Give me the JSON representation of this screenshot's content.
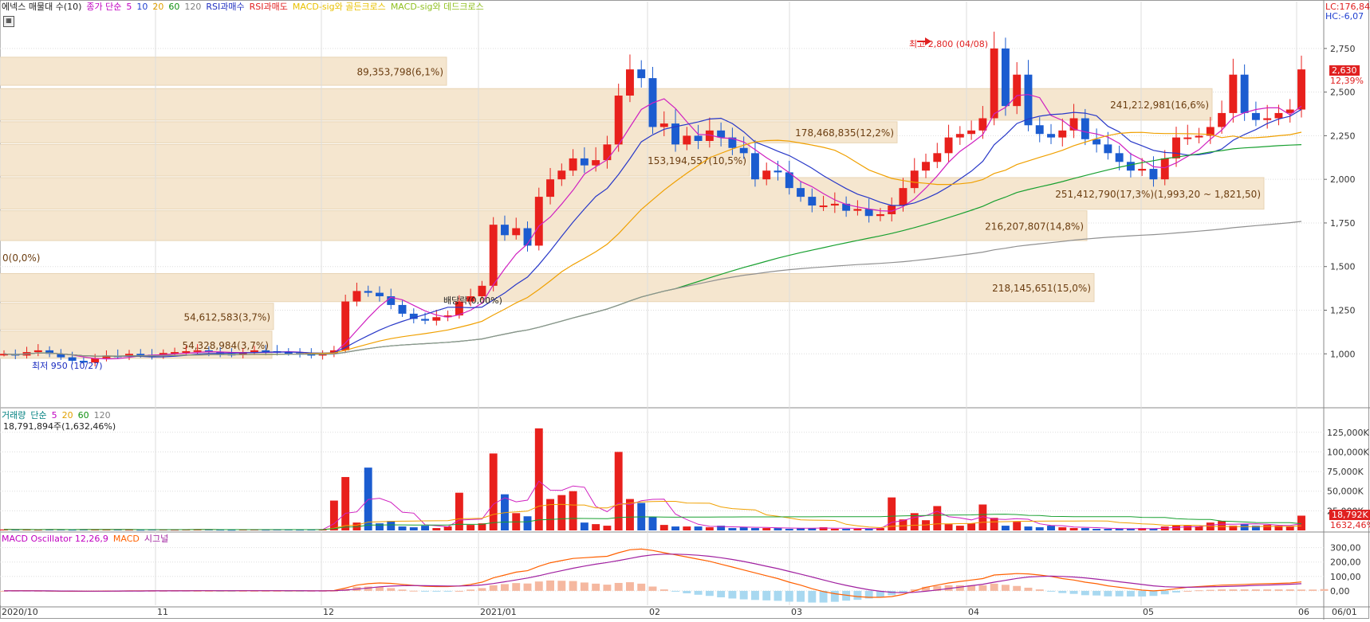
{
  "legend": {
    "main": [
      {
        "text": "에넥스 매물대 수(10)",
        "color": "#222222"
      },
      {
        "text": "종가 단순",
        "color": "#c000c0"
      },
      {
        "text": "5",
        "color": "#c000c0"
      },
      {
        "text": "10",
        "color": "#2040d0"
      },
      {
        "text": "20",
        "color": "#e0a000"
      },
      {
        "text": "60",
        "color": "#109010"
      },
      {
        "text": "120",
        "color": "#808080"
      },
      {
        "text": "RSI과매수",
        "color": "#2030c0"
      },
      {
        "text": "RSI과매도",
        "color": "#e02020"
      },
      {
        "text": "MACD-sig와 골든크로스",
        "color": "#e8c000"
      },
      {
        "text": "MACD-sig와 데드크로스",
        "color": "#90c020"
      }
    ],
    "volume": [
      {
        "text": "거래량",
        "color": "#008080"
      },
      {
        "text": "단순",
        "color": "#008080"
      },
      {
        "text": "5",
        "color": "#c000c0"
      },
      {
        "text": "20",
        "color": "#e0a000"
      },
      {
        "text": "60",
        "color": "#109010"
      },
      {
        "text": "120",
        "color": "#808080"
      }
    ],
    "volume_value": "18,791,894주(1,632,46%)",
    "macd": [
      {
        "text": "MACD Oscillator 12,26,9",
        "color": "#c000c0"
      },
      {
        "text": "MACD",
        "color": "#ff6000"
      },
      {
        "text": "시그널",
        "color": "#a020a0"
      }
    ]
  },
  "corner": {
    "lc": "LC:176,84",
    "hc": "HC:-6,07"
  },
  "price_ticks": [
    "2,750",
    "2,500",
    "2,250",
    "2,000",
    "1,750",
    "1,500",
    "1,250",
    "1,000"
  ],
  "volume_ticks": [
    "125,000K",
    "100,000K",
    "75,000K",
    "50,000K",
    "25,000K"
  ],
  "macd_ticks": [
    "300,00",
    "200,00",
    "100,00",
    "0,00"
  ],
  "x_labels": [
    "2020/10",
    "11",
    "12",
    "2021/01",
    "02",
    "03",
    "04",
    "05",
    "06",
    "06/01"
  ],
  "current_price_tag": "2,630",
  "current_price_pct": "12,39%",
  "volume_tag": "18,792K",
  "volume_pct": "1632,46%",
  "annotations": {
    "high": "최고 2,800 (04/08)",
    "low": "최저 950 (10/27)",
    "dividend": "배당락(0,00%)"
  },
  "volume_profile": [
    {
      "label": "89,353,798(6,1%)"
    },
    {
      "label": "241,212,981(16,6%)"
    },
    {
      "label": "178,468,835(12,2%)"
    },
    {
      "label": "153,194,557(10,5%)"
    },
    {
      "label": "251,412,790(17,3%)(1,993,20 ~ 1,821,50)"
    },
    {
      "label": "216,207,807(14,8%)"
    },
    {
      "label": "0(0,0%)"
    },
    {
      "label": "218,145,651(15,0%)"
    },
    {
      "label": "54,612,583(3,7%)"
    },
    {
      "label": "54,328,984(3,7%)"
    }
  ],
  "colors": {
    "up": "#e8201c",
    "down": "#1b5cd0",
    "ma5": "#d020c0",
    "ma10": "#2838c8",
    "ma20": "#f0a000",
    "ma60": "#18a030",
    "ma120": "#909090",
    "box": "#f5e6cf",
    "grid": "#dddddd"
  },
  "chart_data": [
    {
      "type": "candlestick",
      "title": "에넥스",
      "ylim": [
        700,
        2900
      ],
      "x_axis_labels": [
        "2020/10",
        "11",
        "12",
        "2021/01",
        "02",
        "03",
        "04",
        "05",
        "06"
      ],
      "annotated_high": 2800,
      "annotated_low": 950,
      "last_close": 2630,
      "close_series": [
        1000,
        990,
        1010,
        1020,
        1000,
        980,
        960,
        950,
        975,
        990,
        985,
        1000,
        995,
        990,
        1005,
        1010,
        1015,
        1020,
        1010,
        1000,
        995,
        1010,
        1020,
        1015,
        1010,
        1005,
        1000,
        990,
        1000,
        1020,
        1300,
        1360,
        1350,
        1330,
        1280,
        1230,
        1200,
        1190,
        1210,
        1220,
        1300,
        1330,
        1390,
        1740,
        1680,
        1720,
        1620,
        1900,
        2000,
        2050,
        2120,
        2080,
        2110,
        2200,
        2480,
        2630,
        2580,
        2300,
        2320,
        2200,
        2250,
        2220,
        2280,
        2240,
        2180,
        2150,
        2000,
        2050,
        2040,
        1950,
        1900,
        1850,
        1850,
        1860,
        1820,
        1830,
        1790,
        1800,
        1850,
        1950,
        2050,
        2100,
        2150,
        2240,
        2260,
        2280,
        2350,
        2750,
        2420,
        2600,
        2310,
        2260,
        2240,
        2280,
        2350,
        2230,
        2200,
        2150,
        2100,
        2050,
        2060,
        2000,
        2120,
        2240,
        2240,
        2250,
        2300,
        2380,
        2600,
        2380,
        2340,
        2350,
        2380,
        2400,
        2630
      ]
    },
    {
      "type": "bar",
      "title": "거래량",
      "unit": "K",
      "ylim": [
        0,
        140000
      ],
      "last_value": 18792,
      "values": [
        1200,
        1000,
        1100,
        900,
        1300,
        1000,
        900,
        1400,
        1200,
        1100,
        1000,
        900,
        800,
        1000,
        1100,
        900,
        1200,
        1300,
        1000,
        900,
        800,
        1000,
        1100,
        900,
        1000,
        1200,
        900,
        1000,
        1300,
        38000,
        68000,
        10000,
        80000,
        9000,
        12000,
        5000,
        4000,
        6000,
        3000,
        5000,
        48000,
        7000,
        9000,
        98000,
        46000,
        22000,
        18000,
        130000,
        40000,
        45000,
        50000,
        10000,
        8000,
        6000,
        100000,
        40000,
        35000,
        17000,
        7000,
        5000,
        5000,
        5000,
        4000,
        6000,
        3000,
        4000,
        3000,
        3000,
        3000,
        2000,
        3000,
        3000,
        4000,
        2000,
        2000,
        2000,
        2000,
        3000,
        42000,
        14000,
        22000,
        13000,
        31000,
        8000,
        6000,
        9000,
        33000,
        16000,
        6000,
        11000,
        5000,
        4000,
        6000,
        4000,
        3000,
        3000,
        2000,
        2000,
        2000,
        2000,
        3000,
        2000,
        5000,
        7000,
        6000,
        5000,
        10000,
        12000,
        6000,
        8000,
        6000,
        7000,
        6000,
        5000,
        18792
      ]
    },
    {
      "type": "area",
      "title": "MACD Oscillator 12,26,9",
      "ylim": [
        -100,
        320
      ],
      "series": [
        {
          "name": "MACD",
          "values": [
            0,
            1,
            1,
            0,
            -1,
            -2,
            -3,
            -3,
            -2,
            -1,
            -1,
            0,
            0,
            0,
            0,
            1,
            1,
            1,
            1,
            0,
            0,
            1,
            1,
            1,
            1,
            0,
            0,
            0,
            0,
            2,
            20,
            40,
            50,
            55,
            52,
            45,
            38,
            32,
            30,
            30,
            34,
            45,
            60,
            90,
            110,
            130,
            140,
            170,
            195,
            210,
            225,
            230,
            235,
            240,
            265,
            285,
            290,
            280,
            265,
            250,
            235,
            220,
            205,
            185,
            165,
            145,
            125,
            105,
            85,
            60,
            40,
            15,
            -5,
            -20,
            -30,
            -40,
            -45,
            -45,
            -40,
            -25,
            0,
            25,
            40,
            55,
            65,
            75,
            85,
            110,
            115,
            120,
            118,
            110,
            100,
            85,
            75,
            60,
            50,
            35,
            25,
            15,
            5,
            0,
            5,
            15,
            25,
            30,
            35,
            40,
            42,
            45,
            48,
            50,
            52,
            55,
            62
          ]
        },
        {
          "name": "시그널",
          "values": [
            0,
            0,
            0,
            0,
            0,
            -1,
            -1,
            -2,
            -2,
            -2,
            -1,
            -1,
            -1,
            0,
            0,
            0,
            0,
            1,
            1,
            1,
            1,
            1,
            1,
            1,
            1,
            1,
            1,
            0,
            0,
            1,
            5,
            12,
            20,
            28,
            33,
            36,
            37,
            36,
            35,
            34,
            34,
            36,
            41,
            51,
            63,
            76,
            89,
            105,
            123,
            140,
            157,
            172,
            185,
            197,
            210,
            225,
            240,
            250,
            255,
            255,
            252,
            247,
            240,
            230,
            218,
            204,
            188,
            171,
            154,
            135,
            116,
            96,
            76,
            56,
            38,
            22,
            8,
            -3,
            -10,
            -13,
            -10,
            -3,
            6,
            16,
            26,
            36,
            46,
            60,
            73,
            86,
            96,
            100,
            102,
            100,
            96,
            90,
            82,
            73,
            63,
            54,
            44,
            35,
            29,
            26,
            25,
            26,
            28,
            30,
            32,
            35,
            38,
            40,
            43,
            46,
            50
          ]
        },
        {
          "name": "MACD Oscillator 12,26,9",
          "values": [
            0,
            1,
            1,
            0,
            -1,
            -1,
            -2,
            -1,
            0,
            1,
            0,
            1,
            1,
            0,
            0,
            1,
            1,
            0,
            0,
            -1,
            -1,
            0,
            0,
            0,
            0,
            -1,
            -1,
            0,
            0,
            1,
            15,
            28,
            30,
            27,
            19,
            9,
            1,
            -4,
            -5,
            -4,
            0,
            9,
            19,
            39,
            47,
            54,
            51,
            65,
            72,
            70,
            68,
            58,
            50,
            43,
            55,
            60,
            50,
            30,
            10,
            -5,
            -17,
            -27,
            -35,
            -45,
            -53,
            -59,
            -63,
            -66,
            -69,
            -75,
            -76,
            -81,
            -81,
            -76,
            -68,
            -62,
            -53,
            -42,
            -30,
            -12,
            10,
            28,
            34,
            39,
            39,
            39,
            39,
            50,
            42,
            34,
            22,
            10,
            -2,
            -15,
            -21,
            -30,
            -32,
            -38,
            -38,
            -39,
            -39,
            -35,
            -24,
            -11,
            0,
            4,
            7,
            10,
            10,
            10,
            10,
            10,
            10,
            10,
            9,
            9,
            12
          ]
        }
      ]
    }
  ]
}
